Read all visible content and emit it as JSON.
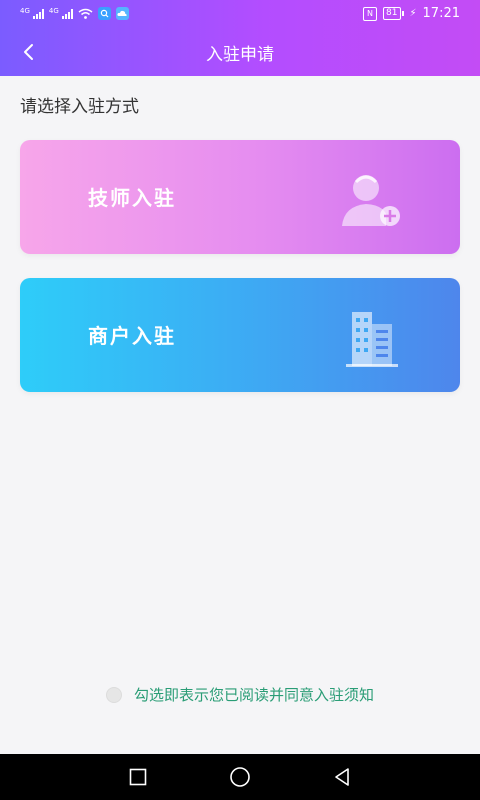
{
  "status_bar": {
    "net1": "4G",
    "net2": "4G",
    "nfc": "N",
    "battery": "81",
    "time": "17:21"
  },
  "header": {
    "title": "入驻申请"
  },
  "prompt": "请选择入驻方式",
  "options": [
    {
      "label": "技师入驻",
      "icon": "person-add-icon"
    },
    {
      "label": "商户入驻",
      "icon": "building-icon"
    }
  ],
  "agreement": {
    "text": "勾选即表示您已阅读并同意入驻须知",
    "checked": false
  },
  "colors": {
    "header_gradient": [
      "#7b5cff",
      "#c34cf5"
    ],
    "tech_card_gradient": [
      "#f7a6ea",
      "#cc6ef0"
    ],
    "merchant_card_gradient": [
      "#2ecdf9",
      "#4e86ec"
    ],
    "agreement_text": "#2a9d76"
  }
}
